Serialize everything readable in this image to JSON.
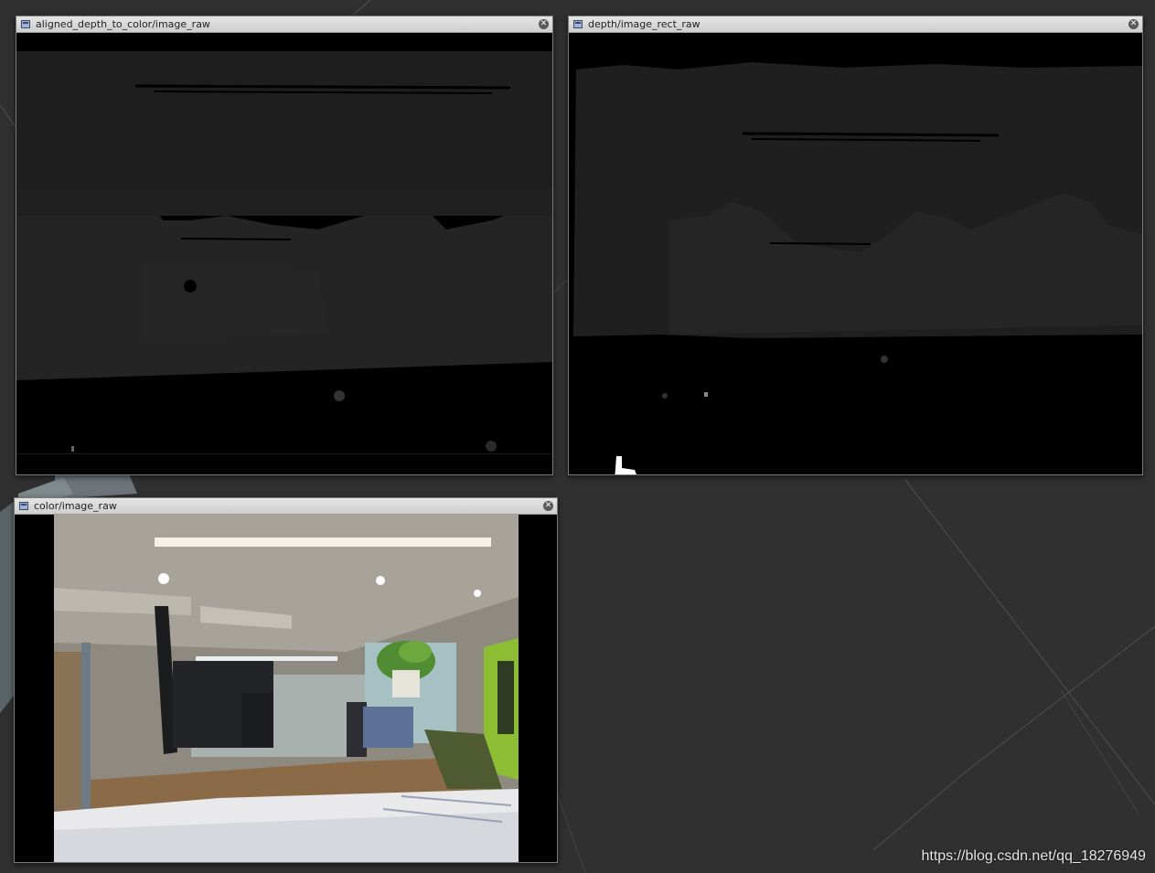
{
  "windows": {
    "aligned_depth": {
      "title": "aligned_depth_to_color/image_raw",
      "close_icon": "close-icon"
    },
    "depth_rect": {
      "title": "depth/image_rect_raw",
      "close_icon": "close-icon"
    },
    "color": {
      "title": "color/image_raw",
      "close_icon": "close-icon"
    }
  },
  "watermark": "https://blog.csdn.net/qq_18276949",
  "colors": {
    "desktop": "#303030",
    "titlebar": "#d6d6d6",
    "depth_gray": "#262626",
    "background_depth": "#000000"
  }
}
